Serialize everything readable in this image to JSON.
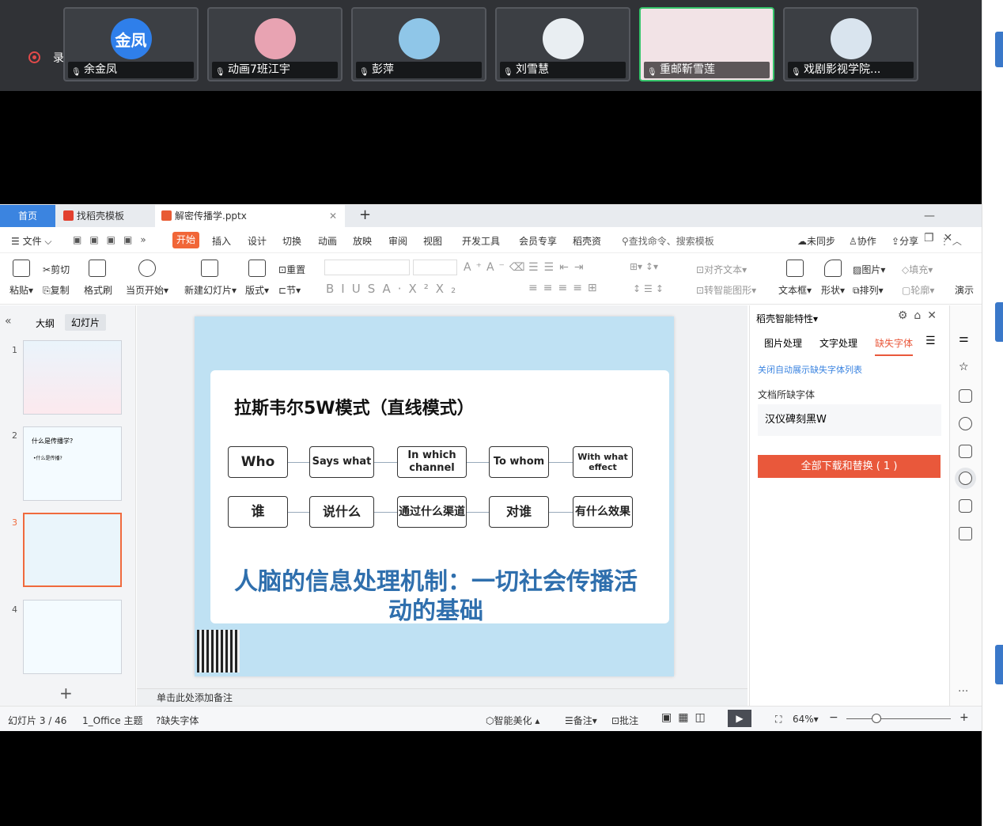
{
  "meeting": {
    "recording_label": "录制中",
    "participants": [
      {
        "name": "余金凤",
        "avatar_text": "金凤",
        "avatar_color": "#2f7fea"
      },
      {
        "name": "动画7班江宇",
        "avatar_text": "",
        "avatar_color": "#e8a3b2"
      },
      {
        "name": "彭萍",
        "avatar_text": "",
        "avatar_color": "#8fc6e8"
      },
      {
        "name": "刘雪慧",
        "avatar_text": "",
        "avatar_color": "#e9eef2"
      },
      {
        "name": "重邮靳雪莲",
        "avatar_text": "",
        "avatar_color": "#f2e3e6"
      },
      {
        "name": "戏剧影视学院...",
        "avatar_text": "",
        "avatar_color": "#d9e4ee"
      }
    ]
  },
  "wps": {
    "tabs": {
      "home": "首页",
      "template": "找稻壳模板",
      "doc": "解密传播学.pptx"
    },
    "menu": {
      "file": "文件",
      "start": "开始",
      "items": [
        "插入",
        "设计",
        "切换",
        "动画",
        "放映",
        "审阅",
        "视图",
        "开发工具",
        "会员专享",
        "稻壳资"
      ],
      "search": "查找命令、搜索模板",
      "unsync": "未同步",
      "collab": "协作",
      "share": "分享"
    },
    "ribbon": {
      "paste": "粘贴",
      "cut": "剪切",
      "copy": "复制",
      "format_painter": "格式刷",
      "from_current": "当页开始",
      "new_slide": "新建幻灯片",
      "layout": "版式",
      "section": "节",
      "reset": "重置",
      "align_text": "对齐文本",
      "smart_shape": "转智能图形",
      "textbox": "文本框",
      "shape": "形状",
      "picture": "图片",
      "arrange": "排列",
      "fill": "填充",
      "outline": "轮廓",
      "present": "演示"
    },
    "left_pane": {
      "tab_outline": "大纲",
      "tab_slides": "幻灯片",
      "thumb_numbers": [
        "1",
        "2",
        "3",
        "4"
      ],
      "thumb2_title": "什么是传播学?",
      "thumb2_sub": "•什么是传播?"
    },
    "slide": {
      "title": "拉斯韦尔5W模式（直线模式）",
      "row_en": [
        "Who",
        "Says what",
        "In which channel",
        "To whom",
        "With what effect"
      ],
      "row_cn": [
        "谁",
        "说什么",
        "通过什么渠道",
        "对谁",
        "有什么效果"
      ],
      "caption": "人脑的信息处理机制：一切社会传播活动的基础"
    },
    "notes": "单击此处添加备注",
    "right_pane": {
      "title": "稻壳智能特性",
      "tabs": [
        "图片处理",
        "文字处理",
        "缺失字体"
      ],
      "close_link": "关闭自动展示缺失字体列表",
      "missing_label": "文档所缺字体",
      "font_name": "汉仪碑刻黑W",
      "download_button": "全部下载和替换 ( 1 )",
      "accent": "#e9583b"
    },
    "status": {
      "slide_count": "幻灯片 3 / 46",
      "theme": "1_Office 主题",
      "missing_font": "缺失字体",
      "beautify": "智能美化",
      "notes": "备注",
      "comment": "批注",
      "zoom": "64%"
    }
  }
}
